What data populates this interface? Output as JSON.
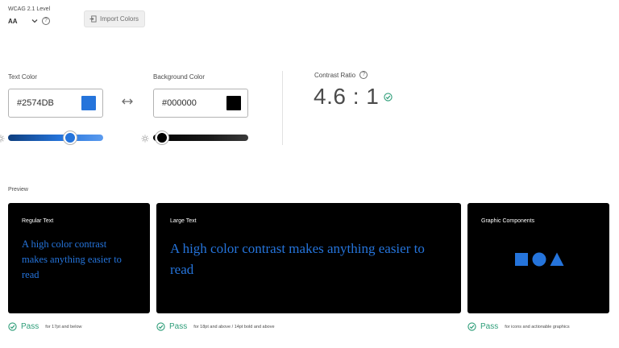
{
  "wcag": {
    "label": "WCAG 2.1 Level",
    "value": "AA"
  },
  "import_button": {
    "label": "Import Colors"
  },
  "text_color": {
    "label": "Text Color",
    "value": "#2574DB",
    "swatch": "#2574DB",
    "slider_level": 0.68
  },
  "background_color": {
    "label": "Background Color",
    "value": "#000000",
    "swatch": "#000000",
    "slider_level": 0.03
  },
  "contrast": {
    "label": "Contrast Ratio",
    "value": "4.6 : 1",
    "status_icon": "check-circle-icon"
  },
  "preview": {
    "label": "Preview",
    "cards": [
      {
        "title": "Regular Text",
        "text": "A high color contrast makes anything easier to read",
        "pass": "Pass",
        "note": "for 17pt and below"
      },
      {
        "title": "Large Text",
        "text": "A high color contrast makes anything easier to read",
        "pass": "Pass",
        "note": "for 18pt and above / 14pt bold and above"
      },
      {
        "title": "Graphic Components",
        "shapes": [
          "square",
          "circle",
          "triangle"
        ],
        "pass": "Pass",
        "note": "for icons and actionable graphics"
      }
    ]
  },
  "colors": {
    "pass_green": "#2d9d78",
    "accent_blue": "#2574DB",
    "card_bg": "#000000"
  }
}
